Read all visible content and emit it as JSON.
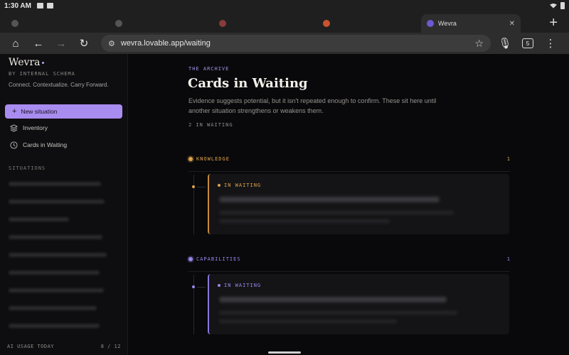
{
  "status_bar": {
    "time": "1:30 AM"
  },
  "browser": {
    "tabs": [
      {
        "title": "",
        "active": false
      },
      {
        "title": "",
        "active": false
      },
      {
        "title": "",
        "active": false
      },
      {
        "title": "",
        "active": false
      },
      {
        "title": "Wevra",
        "active": true
      }
    ],
    "url": "wevra.lovable.app/waiting",
    "tab_count": "5"
  },
  "sidebar": {
    "brand": "Wevra",
    "brand_sub": "BY INTERNAL SCHEMA",
    "tagline": "Connect. Contextualize. Carry Forward.",
    "new_button": "New situation",
    "nav": [
      {
        "label": "Inventory",
        "icon": "layers-icon"
      },
      {
        "label": "Cards in Waiting",
        "icon": "clock-icon"
      }
    ],
    "situations_label": "SITUATIONS",
    "usage_label": "AI USAGE TODAY",
    "usage_value": "8 / 12"
  },
  "main": {
    "eyebrow": "THE ARCHIVE",
    "title": "Cards in Waiting",
    "description": "Evidence suggests potential, but it isn't repeated enough to confirm. These sit here until another situation strengthens or weakens them.",
    "count": "2 IN WAITING",
    "groups": [
      {
        "label": "KNOWLEDGE",
        "count": "1",
        "color": "#e0a24a",
        "card_status": "IN WAITING"
      },
      {
        "label": "CAPABILITIES",
        "count": "1",
        "color": "#9a86ec",
        "card_status": "IN WAITING"
      }
    ]
  },
  "colors": {
    "accent": "#a98cf0",
    "knowledge": "#e0a24a",
    "capabilities": "#9a86ec"
  }
}
